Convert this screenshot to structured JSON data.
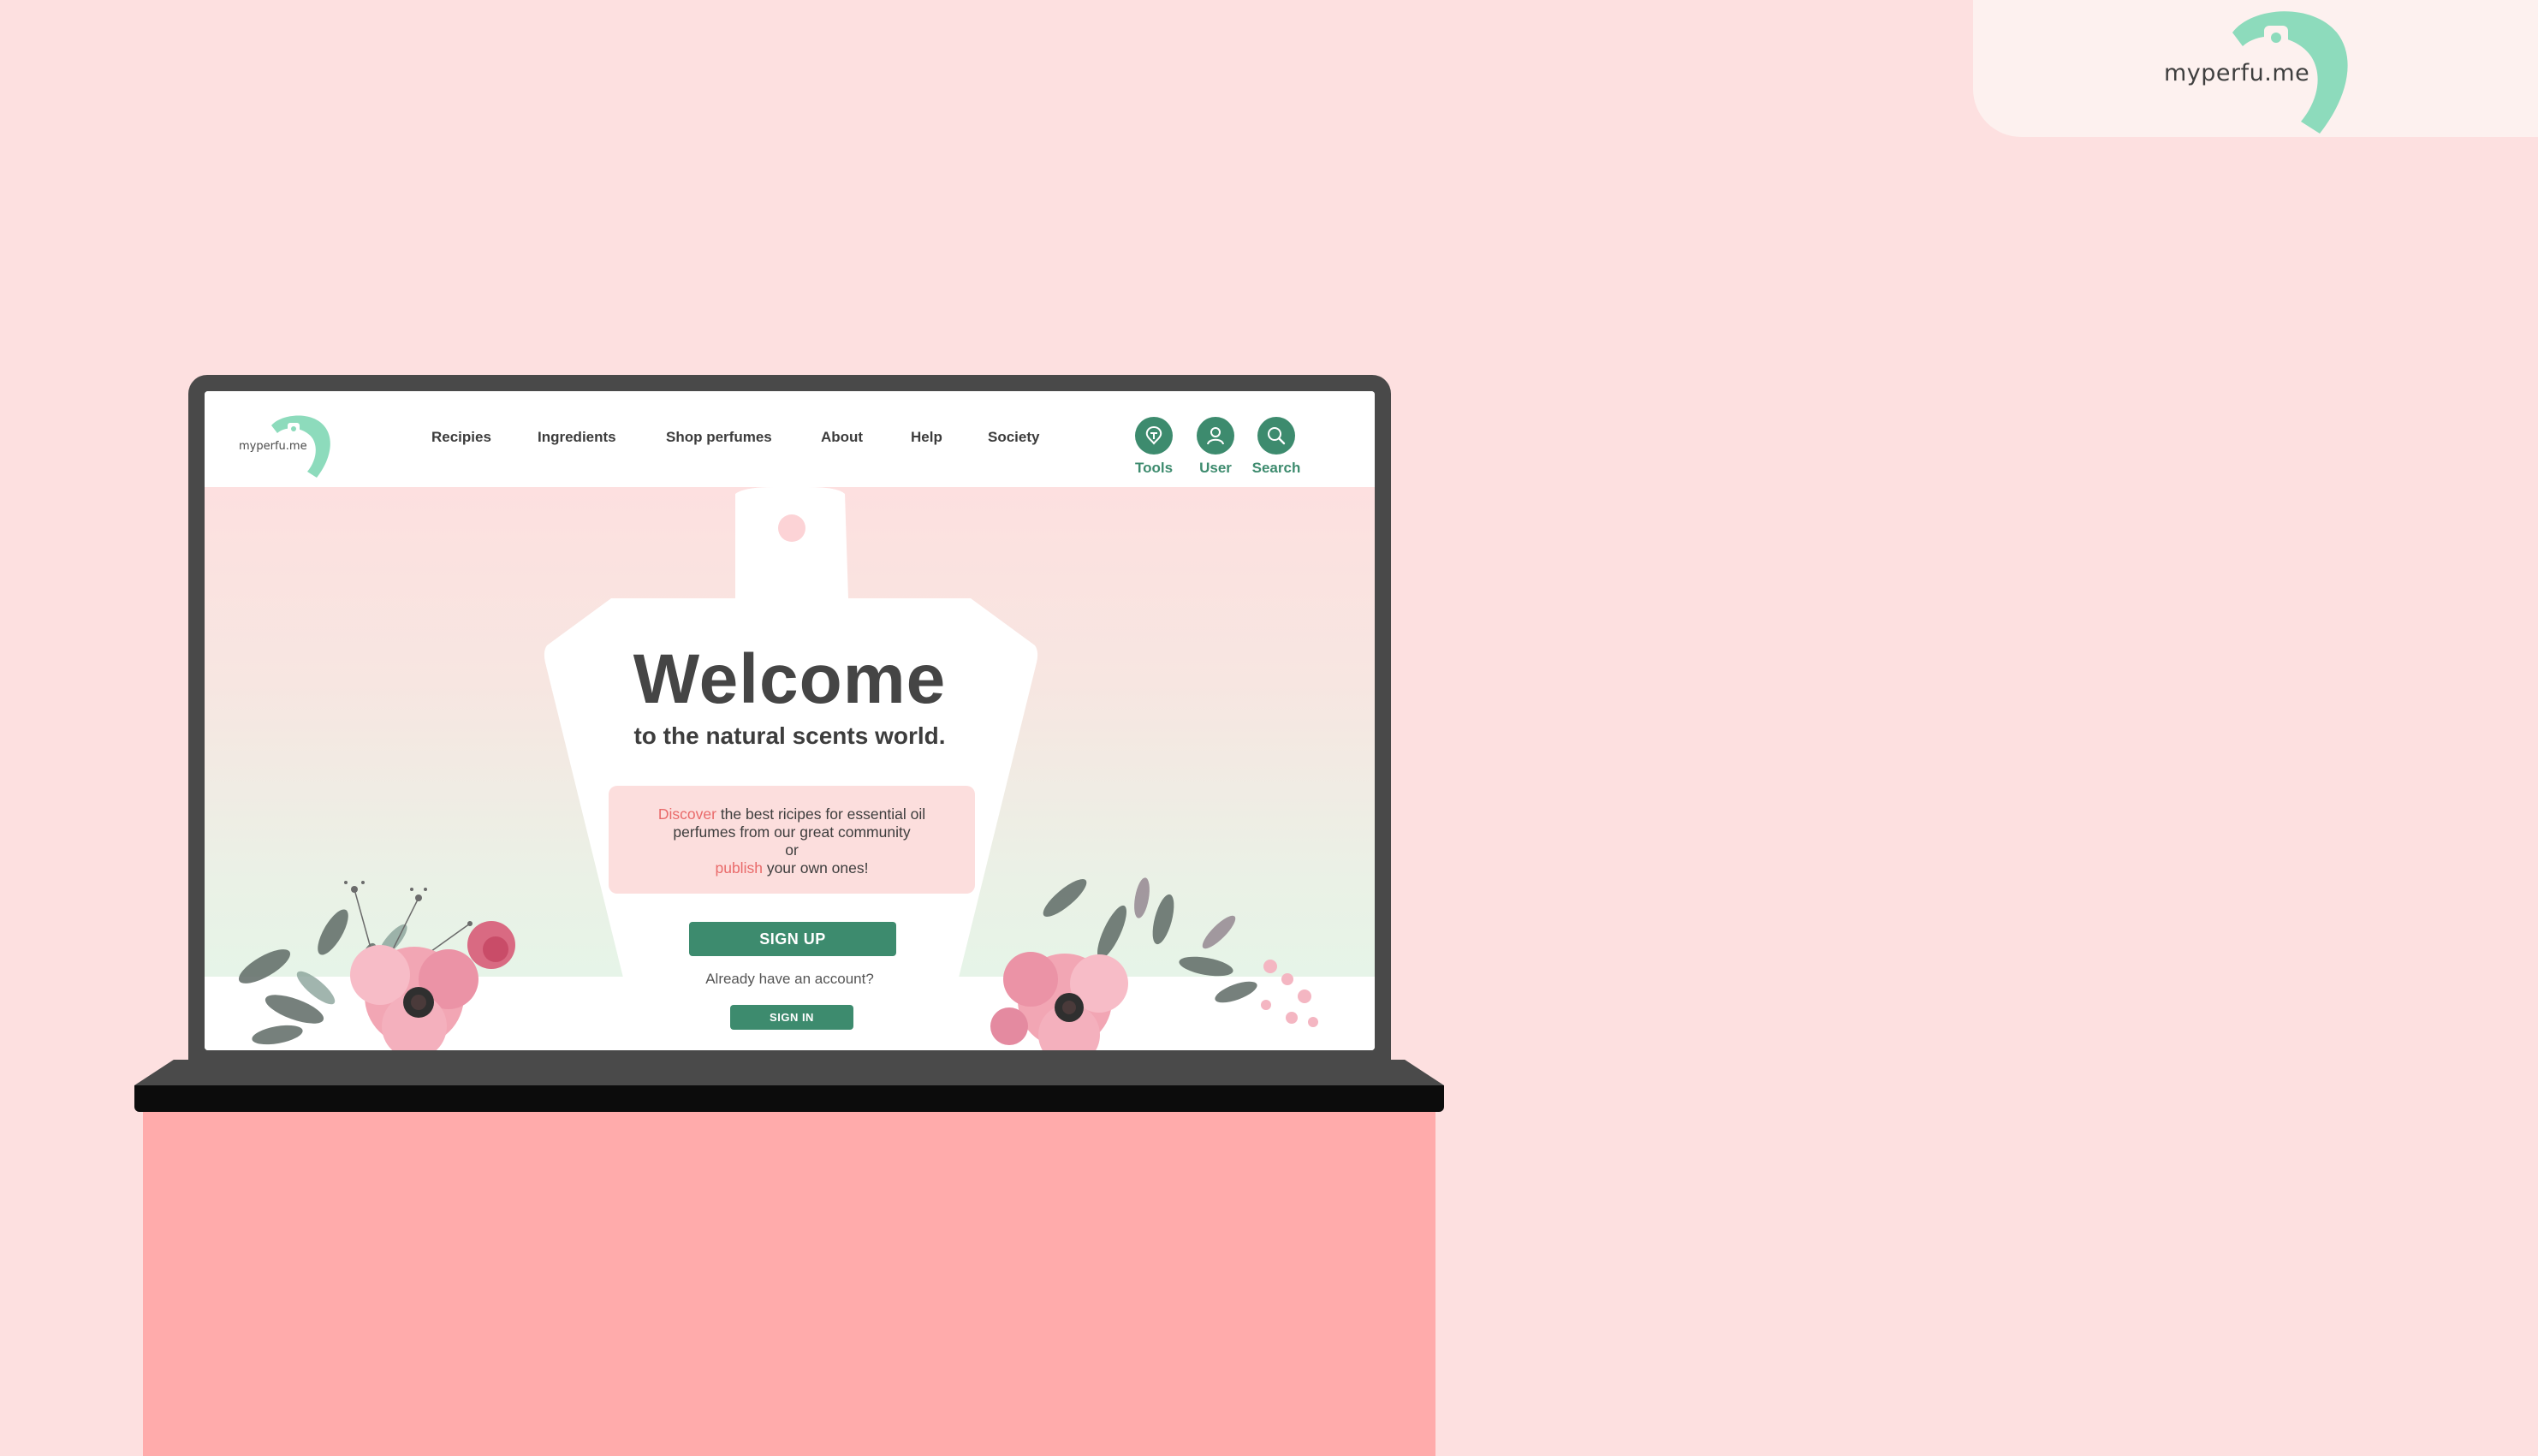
{
  "brand": {
    "name": "myperfu.me",
    "logo_icon": "perfume-bottle-logo-icon",
    "logo_color": "#8ddbbc"
  },
  "colors": {
    "background": "#fde0e0",
    "accent_green": "#3d8b6e",
    "accent_pink": "#e96a6a",
    "desk": "#ffabab"
  },
  "site": {
    "logo_text": "myperfu.me",
    "nav": [
      {
        "label": "Recipies"
      },
      {
        "label": "Ingredients"
      },
      {
        "label": "Shop perfumes"
      },
      {
        "label": "About"
      },
      {
        "label": "Help"
      },
      {
        "label": "Society"
      }
    ],
    "tools": [
      {
        "label": "Tools",
        "icon": "tools-icon"
      },
      {
        "label": "User",
        "icon": "user-icon"
      },
      {
        "label": "Search",
        "icon": "search-icon"
      }
    ]
  },
  "hero": {
    "title": "Welcome",
    "subtitle": "to the natural scents world.",
    "intro": {
      "discover": "Discover",
      "line1_rest": " the best ricipes for essential oil",
      "line2": "perfumes from our great community",
      "line3": "or",
      "publish": "publish",
      "line4_rest": " your own ones!"
    },
    "signup_label": "SIGN UP",
    "already_account": "Already have an account?",
    "signin_label": "SIGN IN"
  }
}
